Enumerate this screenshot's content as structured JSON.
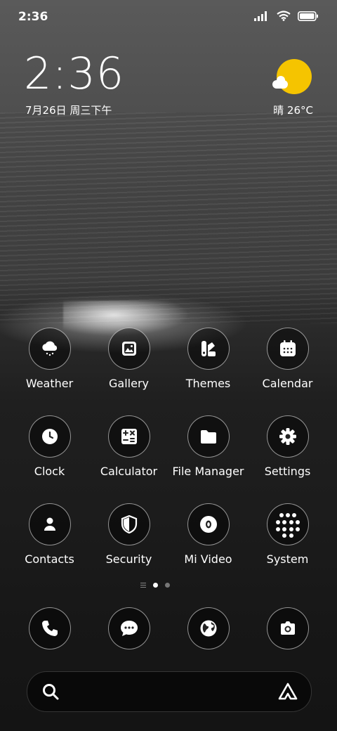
{
  "status_bar": {
    "time": "2:36"
  },
  "lock_widget": {
    "clock": "2:36",
    "date": "7月26日 周三下午",
    "weather": "晴 26°C"
  },
  "apps": [
    {
      "label": "Weather",
      "icon": "weather-icon"
    },
    {
      "label": "Gallery",
      "icon": "gallery-icon"
    },
    {
      "label": "Themes",
      "icon": "themes-icon"
    },
    {
      "label": "Calendar",
      "icon": "calendar-icon"
    },
    {
      "label": "Clock",
      "icon": "clock-icon"
    },
    {
      "label": "Calculator",
      "icon": "calculator-icon"
    },
    {
      "label": "File Manager",
      "icon": "folder-icon"
    },
    {
      "label": "Settings",
      "icon": "gear-icon"
    },
    {
      "label": "Contacts",
      "icon": "contacts-icon"
    },
    {
      "label": "Security",
      "icon": "shield-icon"
    },
    {
      "label": "Mi Video",
      "icon": "video-icon"
    },
    {
      "label": "System",
      "icon": "system-folder-icon"
    }
  ],
  "dock": [
    {
      "icon": "phone-icon"
    },
    {
      "icon": "messages-icon"
    },
    {
      "icon": "browser-icon"
    },
    {
      "icon": "camera-icon"
    }
  ],
  "colors": {
    "sun": "#f5c400",
    "text": "#ffffff"
  }
}
